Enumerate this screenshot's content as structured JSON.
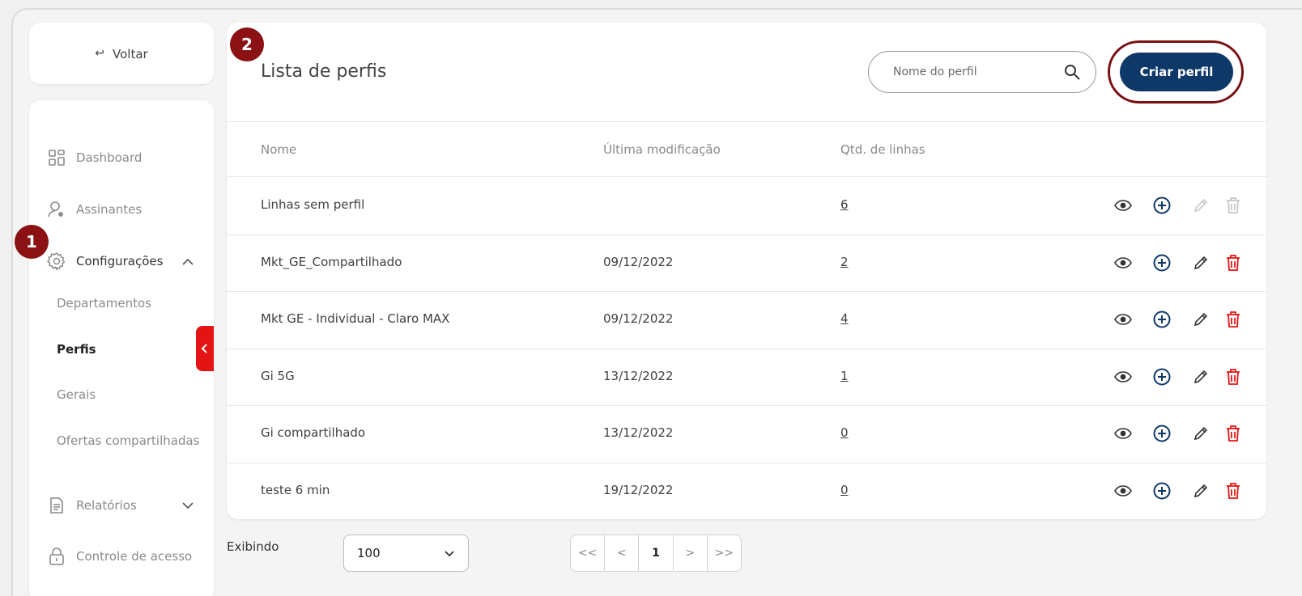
{
  "sidebar": {
    "back_label": "Voltar",
    "items": [
      {
        "label": "Dashboard"
      },
      {
        "label": "Assinantes"
      },
      {
        "label": "Configurações"
      },
      {
        "label": "Relatórios"
      },
      {
        "label": "Controle de acesso"
      }
    ],
    "subitems": [
      {
        "label": "Departamentos"
      },
      {
        "label": "Perfis"
      },
      {
        "label": "Gerais"
      },
      {
        "label": "Ofertas compartilhadas"
      }
    ]
  },
  "badges": {
    "one": "1",
    "two": "2"
  },
  "main": {
    "title": "Lista de perfis",
    "search_placeholder": "Nome do perfil",
    "create_label": "Criar perfil",
    "columns": [
      "Nome",
      "Última modificação",
      "Qtd. de linhas"
    ],
    "rows": [
      {
        "name": "Linhas sem perfil",
        "modified": "",
        "count": "6",
        "editable": false
      },
      {
        "name": "Mkt_GE_Compartilhado",
        "modified": "09/12/2022",
        "count": "2",
        "editable": true
      },
      {
        "name": "Mkt GE - Individual - Claro MAX",
        "modified": "09/12/2022",
        "count": "4",
        "editable": true
      },
      {
        "name": "Gi 5G",
        "modified": "13/12/2022",
        "count": "1",
        "editable": true
      },
      {
        "name": "Gi compartilhado",
        "modified": "13/12/2022",
        "count": "0",
        "editable": true
      },
      {
        "name": "teste 6 min",
        "modified": "19/12/2022",
        "count": "0",
        "editable": true
      }
    ]
  },
  "footer": {
    "showing_label": "Exibindo",
    "page_size": "100",
    "pager": {
      "first": "<<",
      "prev": "<",
      "current": "1",
      "next": ">",
      "last": ">>"
    }
  },
  "colors": {
    "primary": "#0e3868",
    "accent_dark_red": "#8b1114",
    "delete_red": "#e41414",
    "add_blue": "#0e3868"
  }
}
